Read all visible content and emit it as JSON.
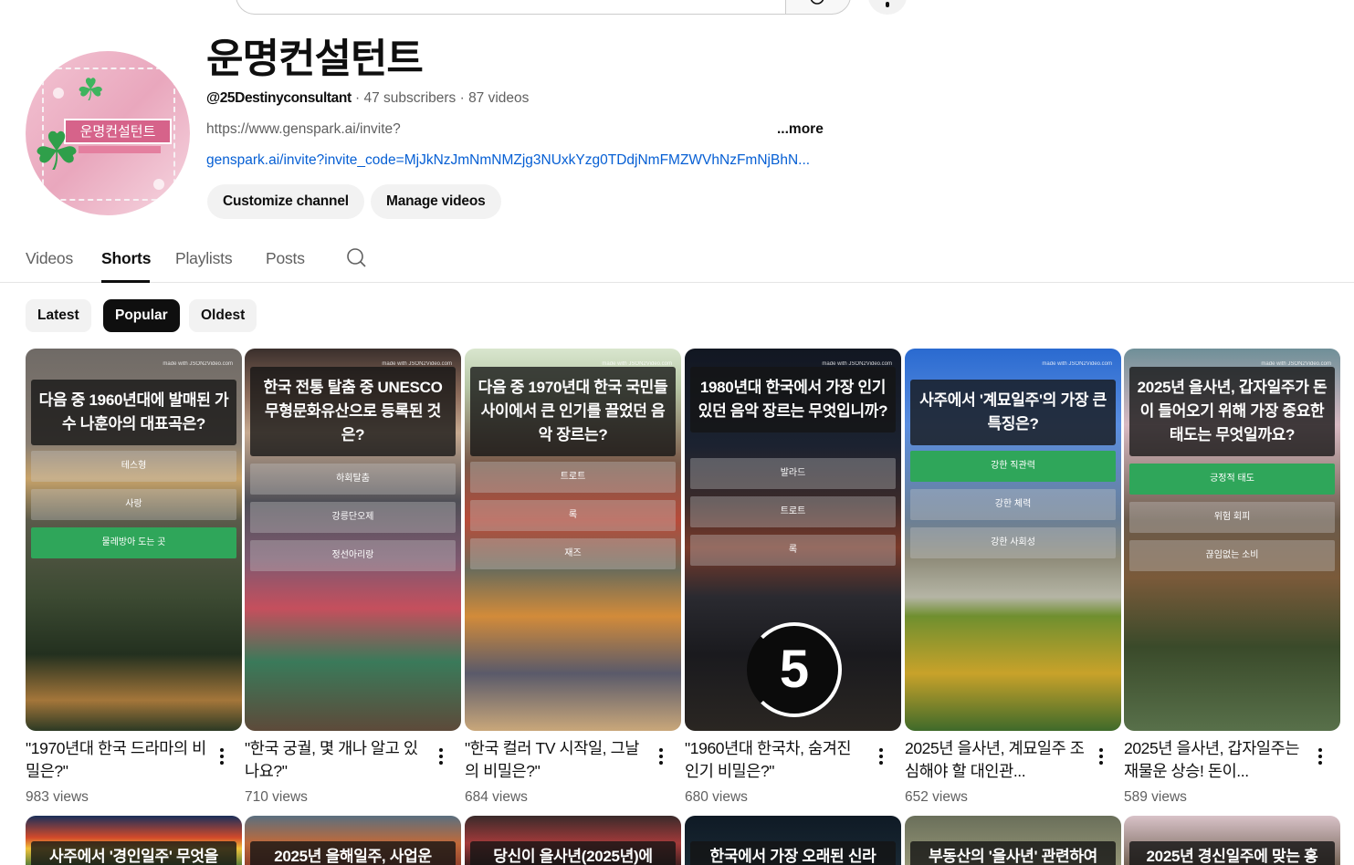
{
  "channel": {
    "name": "운명컨설턴트",
    "avatar_text": "운명컨설턴트",
    "handle": "@25Destinyconsultant",
    "meta_rest": " · 47 subscribers · 87 videos",
    "description": "https://www.genspark.ai/invite?",
    "more": "...more",
    "link": "genspark.ai/invite?invite_code=MjJkNzJmNmNMZjg3NUxkYzg0TDdjNmFMZWVhNzFmNjBhN...",
    "customize_label": "Customize channel",
    "manage_label": "Manage videos"
  },
  "tabs": [
    "Videos",
    "Shorts",
    "Playlists",
    "Posts"
  ],
  "active_tab": "Shorts",
  "chips": [
    "Latest",
    "Popular",
    "Oldest"
  ],
  "active_chip": "Popular",
  "shorts": [
    {
      "question": "다음 중 1960년대에 발매된 가수 나훈아의 대표곡은?",
      "options": [
        "테스형",
        "사랑",
        "물레방아 도는 곳"
      ],
      "correct": 2,
      "title": "\"1970년대 한국 드라마의 비밀은?\"",
      "views": "983 views"
    },
    {
      "question": "한국 전통 탈춤 중 UNESCO 무형문화유산으로 등록된 것은?",
      "options": [
        "하회탈춤",
        "강릉단오제",
        "정선아리랑"
      ],
      "correct": -1,
      "title": "\"한국 궁궐, 몇 개나 알고 있나요?\"",
      "views": "710 views"
    },
    {
      "question": "다음 중 1970년대 한국 국민들 사이에서 큰 인기를 끌었던 음악 장르는?",
      "options": [
        "트로트",
        "록",
        "재즈"
      ],
      "correct": -1,
      "title": "\"한국 컬러 TV 시작일, 그날의 비밀은?\"",
      "views": "684 views"
    },
    {
      "question": "1980년대 한국에서 가장 인기 있던 음악 장르는 무엇입니까?",
      "options": [
        "발라드",
        "트로트",
        "록"
      ],
      "correct": -1,
      "timer": "5",
      "title": "\"1960년대 한국차, 숨겨진 인기 비밀은?\"",
      "views": "680 views"
    },
    {
      "question": "사주에서 '계묘일주'의 가장 큰 특징은?",
      "options": [
        "강한 직관력",
        "강한 체력",
        "강한 사회성"
      ],
      "correct": 0,
      "title": "2025년 을사년, 계묘일주 조심해야 할 대인관...",
      "views": "652 views"
    },
    {
      "question": "2025년 을사년, 갑자일주가 돈이 들어오기 위해 가장 중요한 태도는 무엇일까요?",
      "options": [
        "긍정적 태도",
        "위험 회피",
        "끊임없는 소비"
      ],
      "correct": 0,
      "title": "2025년 을사년, 갑자일주는 재물운 상승! 돈이...",
      "views": "589 views"
    }
  ],
  "row2": [
    "사주에서 '경인일주' 무엇을",
    "2025년 을해일주, 사업운",
    "당신이 을사년(2025년)에",
    "한국에서 가장 오래된 신라",
    "부동산의 '을사년' 관련하여",
    "2025년 경신일주에 맞는 홍"
  ],
  "watermark": "made with JSON2Video.com",
  "colors": {
    "link": "#065fd4",
    "correct_option": "#2fa65a",
    "muted_text": "#606060"
  }
}
